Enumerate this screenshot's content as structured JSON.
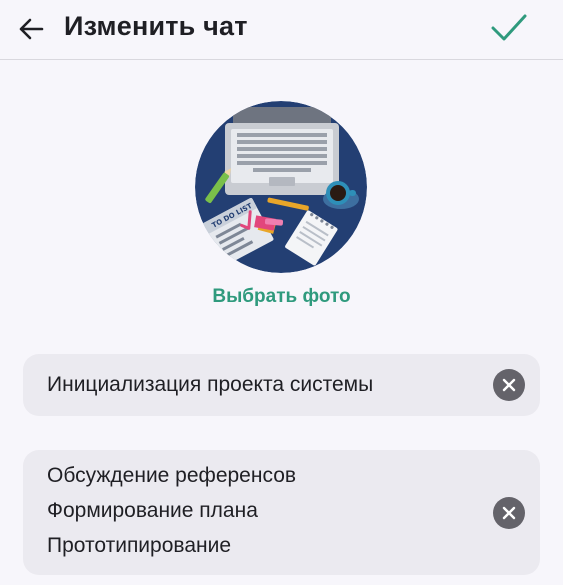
{
  "header": {
    "title": "Изменить чат",
    "back_icon": "arrow-left-icon",
    "confirm_icon": "checkmark-icon"
  },
  "photo": {
    "choose_label": "Выбрать фото",
    "doc_label": "TO DO LIST"
  },
  "fields": {
    "name_value": "Инициализация проекта системы",
    "description_lines": [
      "Обсуждение референсов",
      "Формирование плана",
      "Прототипирование"
    ]
  },
  "colors": {
    "accent": "#2f9a7d",
    "avatar_bg": "#233f73",
    "clear_button": "#64636a",
    "card_bg": "#ebeaf0"
  }
}
